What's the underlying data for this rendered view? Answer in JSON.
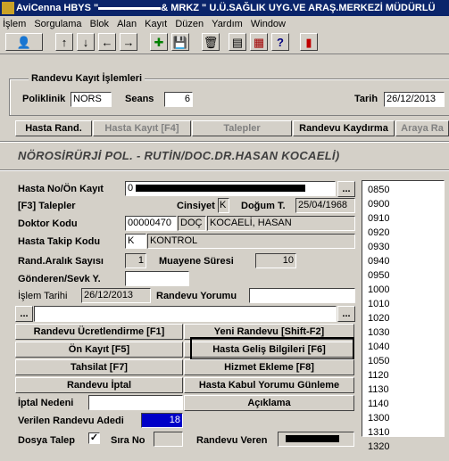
{
  "window": {
    "title_prefix": "AviCenna HBYS \"",
    "title_mid": "& MRKZ \" U.Ü.SAĞLIK UYG.VE ARAŞ.MERKEZİ MÜDÜRLÜ"
  },
  "menu": [
    "İşlem",
    "Sorgulama",
    "Blok",
    "Alan",
    "Kayıt",
    "Düzen",
    "Yardım",
    "Window"
  ],
  "toolbar": {
    "icons": [
      "user-card-icon",
      "arrow-up-icon",
      "arrow-down-icon",
      "arrow-left-icon",
      "arrow-right-icon",
      "new-record-icon",
      "save-icon",
      "trash-icon",
      "calculator-icon",
      "print-icon",
      "help-icon",
      "exit-icon"
    ],
    "glyphs": [
      "👤",
      "↑",
      "↓",
      "←",
      "→",
      "✚",
      "💾",
      "🗑",
      "▤",
      "▦",
      "?",
      "▮"
    ]
  },
  "group": {
    "title": "Randevu Kayıt İşlemleri",
    "poliklinik_label": "Poliklinik",
    "poliklinik_value": "NORS",
    "seans_label": "Seans",
    "seans_value": "6",
    "tarih_label": "Tarih",
    "tarih_value": "26/12/2013"
  },
  "tabs": {
    "hasta_rand": "Hasta Rand.",
    "hasta_kayit": "Hasta Kayıt [F4]",
    "talepler": "Talepler",
    "randevu_kaydirma": "Randevu Kaydırma",
    "araya": "Araya Ra"
  },
  "headline": "NÖROSİRÜRJİ POL. - RUTİN/DOC.DR.HASAN KOCAELİ)",
  "form": {
    "hasta_no_label": "Hasta No/Ön Kayıt",
    "hasta_no_value": "0",
    "ellipsis": "...",
    "talepler_label": "[F3] Talepler",
    "cinsiyet_label": "Cinsiyet",
    "cinsiyet_value": "K",
    "dogum_label": "Doğum T.",
    "dogum_value": "25/04/1968",
    "doktor_label": "Doktor Kodu",
    "doktor_code": "00000470",
    "doktor_title": "DOÇ",
    "doktor_name": "KOCAELİ, HASAN",
    "takip_label": "Hasta Takip Kodu",
    "takip_code": "K",
    "takip_desc": "KONTROL",
    "aralik_label": "Rand.Aralık Sayısı",
    "aralik_value": "1",
    "muayene_label": "Muayene Süresi",
    "muayene_value": "10",
    "gonderen_label": "Gönderen/Sevk Y.",
    "islem_label": "İşlem Tarihi",
    "islem_value": "26/12/2013",
    "yorum_label": "Randevu Yorumu",
    "iptal_label": "İptal Nedeni",
    "verilen_label": "Verilen Randevu Adedi",
    "verilen_value": "18",
    "dosya_label": "Dosya Talep",
    "dosya_checked": "✓",
    "sira_label": "Sıra No",
    "veren_label": "Randevu Veren"
  },
  "buttons": {
    "ucret": "Randevu Ücretlendirme [F1]",
    "yeni": "Yeni Randevu [Shift-F2]",
    "onkayit": "Ön Kayıt [F5]",
    "gelis": "Hasta Geliş Bilgileri [F6]",
    "tahsilat": "Tahsilat [F7]",
    "hizmet": "Hizmet Ekleme [F8]",
    "iptal": "Randevu İptal",
    "kabul": "Hasta Kabul Yorumu Günleme",
    "aciklama": "Açıklama"
  },
  "slots": [
    "0850",
    "0900",
    "0910",
    "0920",
    "0930",
    "0940",
    "0950",
    "1000",
    "1010",
    "1020",
    "1030",
    "1040",
    "1050",
    "1120",
    "1130",
    "1140",
    "1300",
    "1310",
    "1320"
  ],
  "colors": {
    "title_bg": "#0a246a",
    "highlight": "#0000c8",
    "face": "#d4d0c8"
  }
}
